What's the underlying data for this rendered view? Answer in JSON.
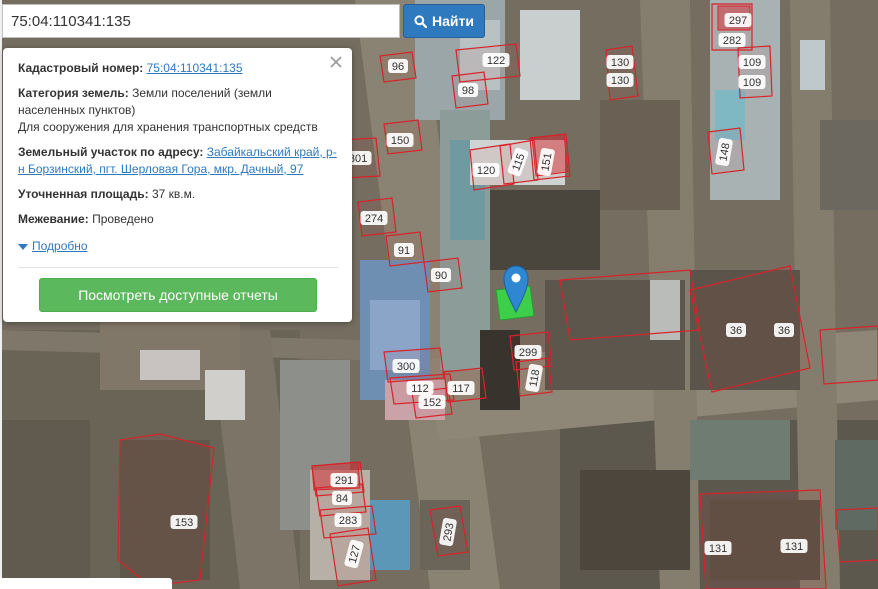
{
  "search": {
    "value": "75:04:110341:135",
    "button_label": "Найти"
  },
  "info": {
    "cadastral_label": "Кадастровый номер:",
    "cadastral_value": "75:04:110341:135",
    "category_label": "Категория земель:",
    "category_value_1": "Земли поселений (земли",
    "category_value_2": "населенных пунктов)",
    "use_text": "Для сооружения для хранения транспортных средств",
    "address_label": "Земельный участок по адресу:",
    "address_value_1": "Забайкальский край, р-",
    "address_value_2": "н Борзинский, пгт. Шерловая Гора, мкр. Дачный, 97",
    "area_label": "Уточненная площадь:",
    "area_value": "37 кв.м.",
    "survey_label": "Межевание:",
    "survey_value": "Проведено",
    "details_link": "Подробно",
    "reports_button": "Посмотреть доступные отчеты"
  },
  "parcel_labels": [
    "297",
    "282",
    "130",
    "130",
    "122",
    "96",
    "109",
    "109",
    "98",
    "148",
    "150",
    "301",
    "120",
    "115",
    "151",
    "274",
    "91",
    "90",
    "36",
    "36",
    "299",
    "300",
    "118",
    "112",
    "117",
    "152",
    "291",
    "84",
    "283",
    "127",
    "293",
    "153",
    "131",
    "131"
  ],
  "colors": {
    "parcel_outline": "#d8232a",
    "selected_parcel": "#3ecf4a",
    "marker": "#2f86d1",
    "search_button": "#2f79bf",
    "reports_button": "#5cb85c"
  }
}
